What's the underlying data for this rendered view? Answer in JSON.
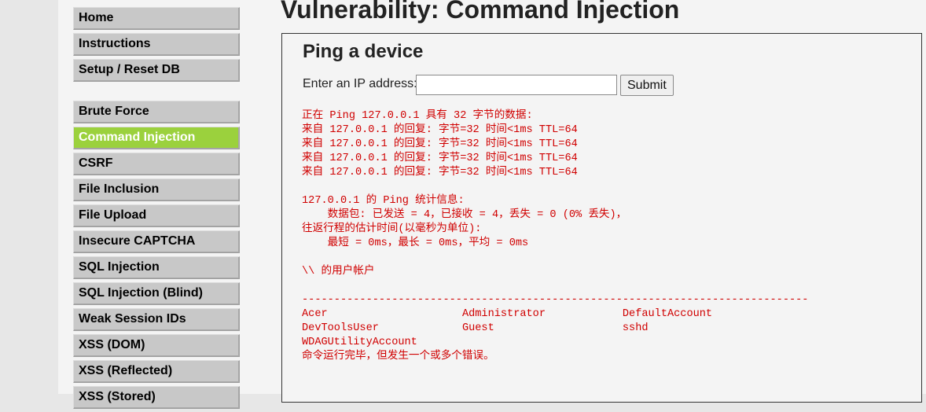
{
  "nav": {
    "group1": [
      {
        "label": "Home",
        "name": "menu-item-home"
      },
      {
        "label": "Instructions",
        "name": "menu-item-instructions"
      },
      {
        "label": "Setup / Reset DB",
        "name": "menu-item-setup-reset-db"
      }
    ],
    "group2": [
      {
        "label": "Brute Force",
        "name": "menu-item-brute-force"
      },
      {
        "label": "Command Injection",
        "name": "menu-item-command-injection",
        "active": true
      },
      {
        "label": "CSRF",
        "name": "menu-item-csrf"
      },
      {
        "label": "File Inclusion",
        "name": "menu-item-file-inclusion"
      },
      {
        "label": "File Upload",
        "name": "menu-item-file-upload"
      },
      {
        "label": "Insecure CAPTCHA",
        "name": "menu-item-insecure-captcha"
      },
      {
        "label": "SQL Injection",
        "name": "menu-item-sql-injection"
      },
      {
        "label": "SQL Injection (Blind)",
        "name": "menu-item-sql-injection-blind"
      },
      {
        "label": "Weak Session IDs",
        "name": "menu-item-weak-session-ids"
      },
      {
        "label": "XSS (DOM)",
        "name": "menu-item-xss-dom"
      },
      {
        "label": "XSS (Reflected)",
        "name": "menu-item-xss-reflected"
      },
      {
        "label": "XSS (Stored)",
        "name": "menu-item-xss-stored"
      }
    ]
  },
  "page": {
    "title": "Vulnerability: Command Injection",
    "heading": "Ping a device",
    "ip_label": "Enter an IP address:",
    "ip_value": "",
    "submit_label": "Submit"
  },
  "output_lines": [
    "正在 Ping 127.0.0.1 具有 32 字节的数据:",
    "来自 127.0.0.1 的回复: 字节=32 时间<1ms TTL=64",
    "来自 127.0.0.1 的回复: 字节=32 时间<1ms TTL=64",
    "来自 127.0.0.1 的回复: 字节=32 时间<1ms TTL=64",
    "来自 127.0.0.1 的回复: 字节=32 时间<1ms TTL=64",
    "",
    "127.0.0.1 的 Ping 统计信息:",
    "    数据包: 已发送 = 4，已接收 = 4，丢失 = 0 (0% 丢失)，",
    "往返行程的估计时间(以毫秒为单位):",
    "    最短 = 0ms，最长 = 0ms，平均 = 0ms",
    "",
    "\\\\ 的用户帐户",
    "",
    "-------------------------------------------------------------------------------",
    "Acer                     Administrator            DefaultAccount",
    "DevToolsUser             Guest                    sshd",
    "WDAGUtilityAccount",
    "命令运行完毕，但发生一个或多个错误。"
  ]
}
